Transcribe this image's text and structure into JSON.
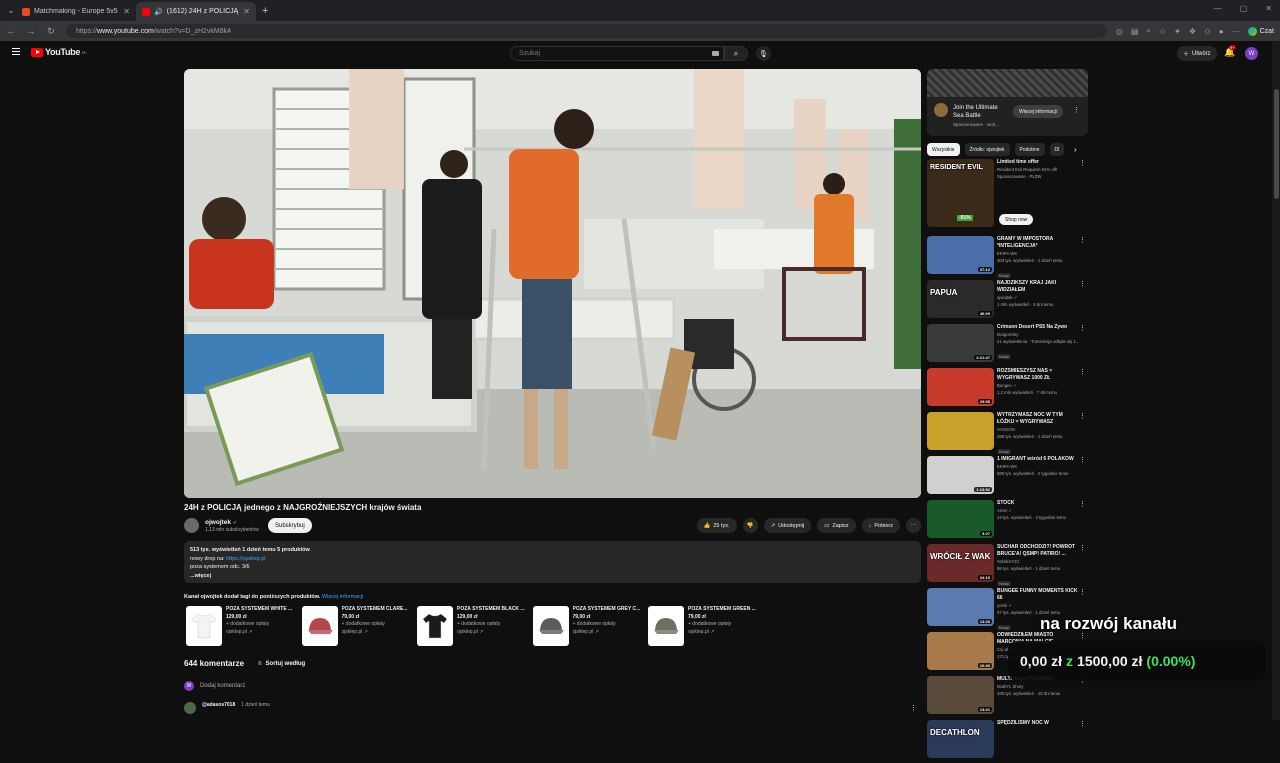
{
  "browser": {
    "tabs": [
      {
        "title": "Matchmaking - Europe 5v5 Queue",
        "active": false,
        "favicon_color": "#e8491d"
      },
      {
        "title": "(1612) 24H z POLICJĄ jednego",
        "active": true,
        "favicon_color": "#ff0000"
      }
    ],
    "url_prefix": "https://",
    "url_host": "www.youtube.com",
    "url_path": "/watch?v=D_zH2vkM8k4",
    "copilot_label": "Czat"
  },
  "header": {
    "logo_text": "YouTube",
    "logo_sup": "PL",
    "search_placeholder": "Szukaj",
    "create_label": "Utwórz",
    "notif_count": "9+",
    "avatar_letter": "W"
  },
  "video": {
    "title": "24H z POLICJĄ jednego z NAJGROŹNIEJSZYCH krajów świata",
    "channel": "ojwojtek",
    "verified_mark": "✓",
    "subs": "1,13 mln subskrybentów",
    "subscribe": "Subskrybuj",
    "likes": "25 tys.",
    "share": "Udostępnij",
    "save": "Zapisz",
    "download": "Pobierz"
  },
  "description": {
    "stats": "513 tys. wyświetleń  1 dzień temu  5 produktów",
    "line2_prefix": "nowy drop na: ",
    "line2_link": "https://ojsklep.pl",
    "line3": "poza systemem odc. 3/6",
    "more": "...więcej"
  },
  "shopping": {
    "heading": "Kanał ojwojtek dodał tagi do poniższych produktów.",
    "more_link": "Więcej informacji",
    "products": [
      {
        "name": "POZA SYSTEMEM WHITE ...",
        "price": "129,00 zł",
        "shipping": "+ dodatkowe opłaty",
        "store": "ojsklep.pl ↗",
        "color": "#f4f4f4",
        "icon": "tshirt-icon"
      },
      {
        "name": "POZA SYSTEMEM CLARE...",
        "price": "79,00 zł",
        "shipping": "+ dodatkowe opłaty",
        "store": "ojsklep.pl ↗",
        "color": "#b5474c",
        "icon": "cap-icon"
      },
      {
        "name": "POZA SYSTEMEM BLACK ...",
        "price": "129,00 zł",
        "shipping": "+ dodatkowe opłaty",
        "store": "ojsklep.pl ↗",
        "color": "#1a1a1a",
        "icon": "tshirt-icon"
      },
      {
        "name": "POZA SYSTEMEM GREY C...",
        "price": "79,00 zł",
        "shipping": "+ dodatkowe opłaty",
        "store": "ojsklep.pl ↗",
        "color": "#5a5d5f",
        "icon": "cap-icon"
      },
      {
        "name": "POZA SYSTEMEM GREEN ...",
        "price": "79,00 zł",
        "shipping": "+ dodatkowe opłaty",
        "store": "ojsklep.pl ↗",
        "color": "#6b7060",
        "icon": "cap-icon"
      }
    ]
  },
  "comments": {
    "count": "644 komentarze",
    "sort": "Sortuj według",
    "add": "Dodaj komentarz",
    "first_user": "@adasos7018",
    "first_time": "1 dzień temu"
  },
  "ad": {
    "title": "Join the Ultimate Sea Battle",
    "sponsored": "Sponsorowane · worl...",
    "button": "Więcej informacji"
  },
  "chips": [
    "Wszystkie",
    "Źródło: ojwojtek",
    "Podobne",
    "Dl"
  ],
  "recommendations": [
    {
      "title": "Limited time offer",
      "channel": "Resident Evil Requiem 91% off!",
      "meta": "Sponsorowane · PLZW",
      "duration": "",
      "badge": "",
      "thumb": "#3a2a1a",
      "shop": "Shop now",
      "thumb_text": "RESIDENT EVIL",
      "sale": "-91%"
    },
    {
      "title": "GRAMY W IMPOSTORA *INTELIGENCJA*",
      "channel": "EKIPA WK",
      "meta": "303 tys. wyświetleń · 1 dzień temu",
      "duration": "37:12",
      "badge": "Nowy",
      "thumb": "#4a6ea8"
    },
    {
      "title": "NAJDZIKSZY KRAJ JAKI WIDZIAŁEM",
      "channel": "ojwojtek ✓",
      "meta": "1 mln wyświetleń · 8 dni temu",
      "duration": "46:09",
      "badge": "",
      "thumb": "#2a2a2a",
      "thumb_text": "PAPUA"
    },
    {
      "title": "Crimson Desert PS5 Na Żywo",
      "channel": "DragonSky",
      "meta": "21 wyświetlenia · Transmisja odbyła się 1...",
      "duration": "2:21:47",
      "badge": "Nowy",
      "thumb": "#3a3a3a"
    },
    {
      "title": "ROZŚMIESZYSZ NAS = WYGRYWASZ 1000 ZŁ",
      "channel": "Bungee ✓",
      "meta": "1,2 mln wyświetleń · 7 dni temu",
      "duration": "29:55",
      "badge": "",
      "thumb": "#c83a2a"
    },
    {
      "title": "WYTRZYMASZ NOC W TYM ŁÓŻKU = WYGRYWASZ",
      "channel": "SAYDON",
      "meta": "286 tys. wyświetleń · 1 dzień temu",
      "duration": "",
      "badge": "Nowy",
      "thumb": "#c8a02a"
    },
    {
      "title": "1 IMIGRANT wśród 6 POLAKÓW",
      "channel": "EKIPA WK",
      "meta": "580 tys. wyświetleń · 2 tygodnie temu",
      "duration": "1:13:52",
      "badge": "",
      "thumb": "#d0d0d0"
    },
    {
      "title": "STOCK",
      "channel": "Amer ✓",
      "meta": "23 tys. wyświetleń · 3 tygodnie temu",
      "duration": "3:27",
      "badge": "",
      "thumb": "#1a5a2a"
    },
    {
      "title": "SUCHAR ODCHODZI?! POWRÓT BRUCE'A! QSMP! PATIRO! ...",
      "channel": "SzfalenYZJ",
      "meta": "88 tys. wyświetleń · 1 dzień temu",
      "duration": "34:19",
      "badge": "Nowy",
      "thumb": "#6a2a2a",
      "thumb_text": "WRÓCIŁ Z WAK"
    },
    {
      "title": "BUNGEE FUNNY MOMENTS KICK 66",
      "channel": "yoshi ✓",
      "meta": "37 tys. wyświetleń · 1 dzień temu",
      "duration": "13:20",
      "badge": "Nowy",
      "thumb": "#5a7ab0"
    },
    {
      "title": "ODWIEDZIŁEM MIASTO MARCONIA NA MALCIE",
      "channel": "Cej ahee ✓",
      "meta": "171 tys. wyświetleń · 13 dni temu",
      "duration": "10:40",
      "badge": "",
      "thumb": "#a87a4a"
    },
    {
      "title": "MULTI nagle PRZERWA ...",
      "channel": "MultiYL Shoty",
      "meta": "330 tys. wyświetleń · 10 dni temu",
      "duration": "13:21",
      "badge": "",
      "thumb": "#5a4a3a"
    },
    {
      "title": "SPĘDZILIŚMY NOC W",
      "channel": "",
      "meta": "",
      "duration": "",
      "badge": "",
      "thumb": "#2a3a5a",
      "thumb_text": "DECATHLON"
    }
  ],
  "overlay": {
    "top": "na rozwój kanału",
    "current": "0,00 zł",
    "z": "z",
    "goal": "1500,00 zł",
    "pct": "(0.00%)",
    "progress_fraction": 0
  },
  "colors": {
    "accent": "#ff0000",
    "link": "#3ea6ff",
    "overlay_green": "#3fe25b"
  }
}
